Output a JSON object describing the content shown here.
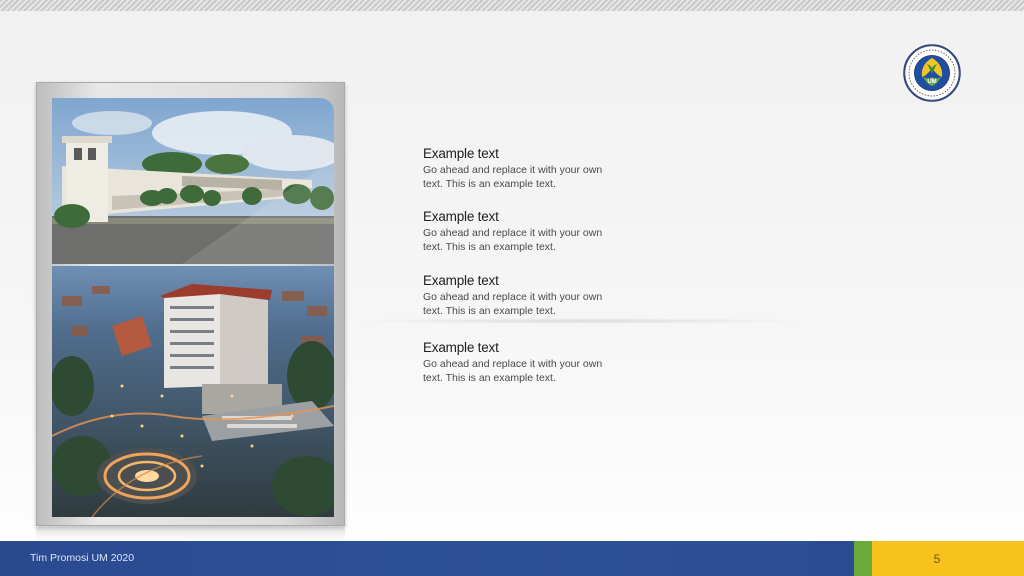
{
  "slide": {
    "blocks": [
      {
        "title": "Example text",
        "body": "Go ahead and replace it with your own text. This is an example text."
      },
      {
        "title": "Example text",
        "body": "Go ahead and replace it with your own text. This is an example text."
      },
      {
        "title": "Example text",
        "body": "Go ahead and replace it with your own text. This is an example text."
      },
      {
        "title": "Example text",
        "body": "Go ahead and replace it with your own text. This is an example text."
      }
    ],
    "logo_icon": "university-seal-icon",
    "photos": [
      "campus-building-photo",
      "campus-aerial-night-photo"
    ]
  },
  "footer": {
    "label": "Tim Promosi UM 2020",
    "page_number": "5"
  },
  "colors": {
    "footer_blue": "#2d5199",
    "footer_green": "#6aab3c",
    "footer_yellow": "#f6c21b"
  }
}
